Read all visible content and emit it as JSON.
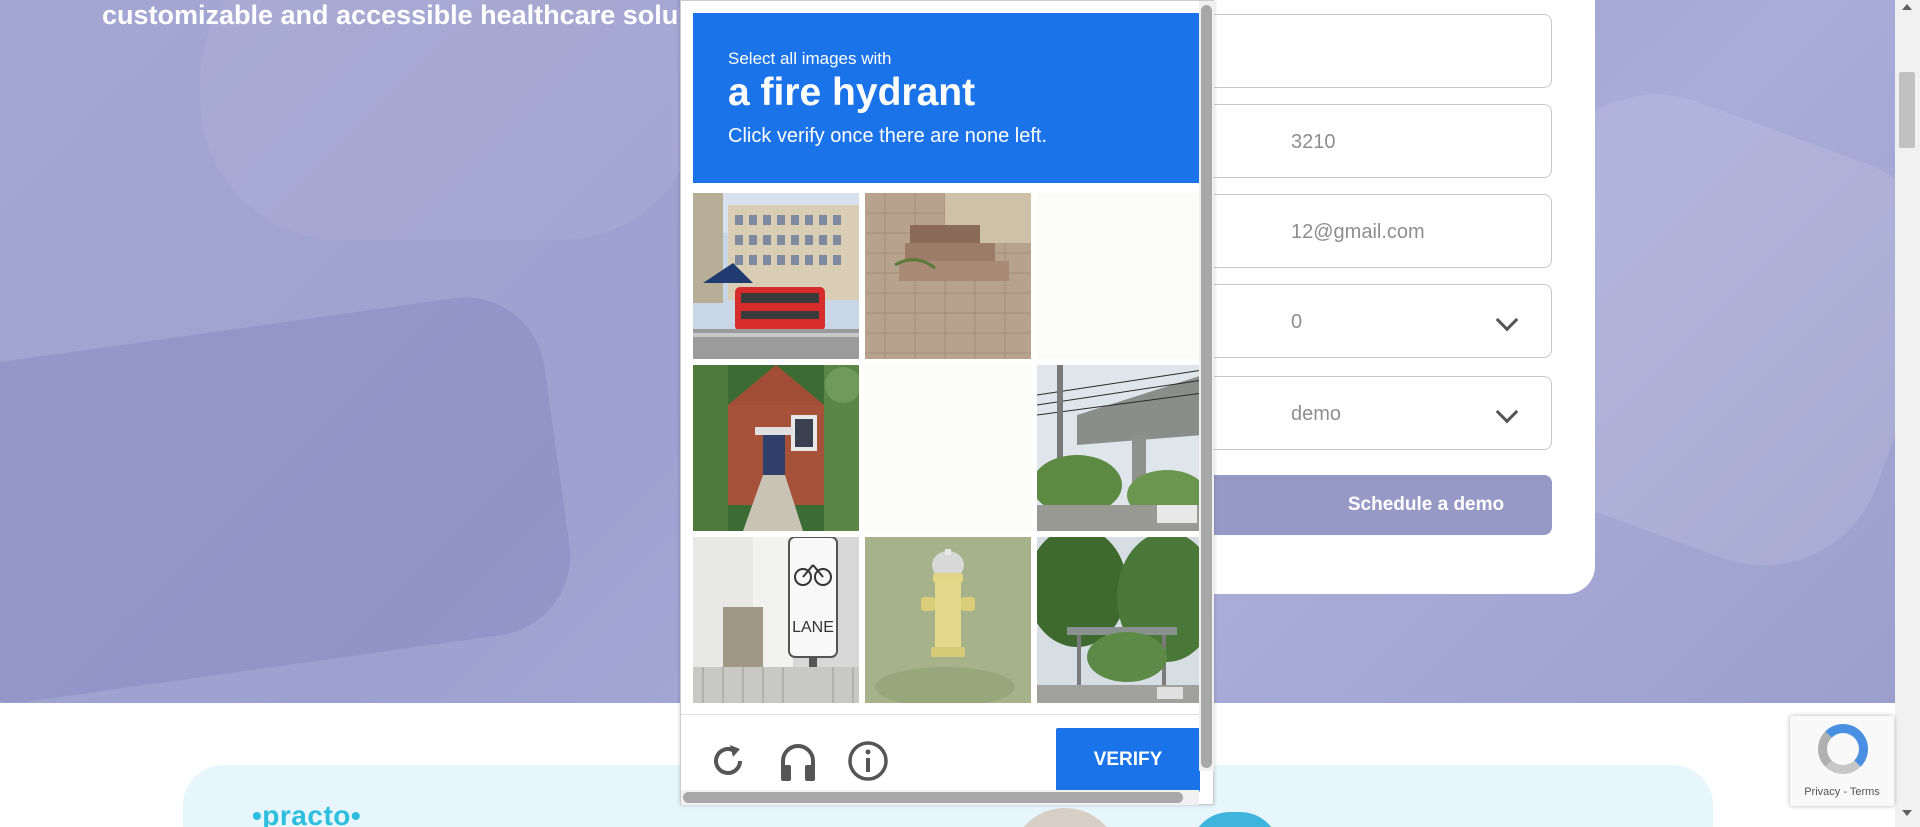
{
  "hero": {
    "text": "customizable and accessible healthcare solu"
  },
  "form": {
    "fields": [
      {
        "value": ""
      },
      {
        "value": "3210"
      },
      {
        "value": "12@gmail.com"
      },
      {
        "value": "0"
      },
      {
        "value": " demo"
      }
    ],
    "schedule_label": "Schedule a demo"
  },
  "lower": {
    "brand": "•practo•"
  },
  "captcha": {
    "instruction_small": "Select all images with",
    "target": "a fire hydrant",
    "hint": "Click verify once there are none left.",
    "tiles": [
      {
        "subject": "street with red double-decker bus"
      },
      {
        "subject": "brick steps on pavement"
      },
      {
        "subject": "blank"
      },
      {
        "subject": "brick house with stairs"
      },
      {
        "subject": "blank"
      },
      {
        "subject": "elevated highway with trees"
      },
      {
        "subject": "bike lane sign"
      },
      {
        "subject": "yellow fire hydrant on grass"
      },
      {
        "subject": "trees by a road"
      }
    ],
    "verify_label": "VERIFY",
    "icons": [
      "reload-icon",
      "audio-icon",
      "info-icon"
    ]
  },
  "recaptcha_badge": {
    "terms": "Privacy - Terms"
  },
  "colors": {
    "captcha_blue": "#1a73e8",
    "hero_bg": "#a4a6d2",
    "schedule_btn": "#9699c6"
  }
}
